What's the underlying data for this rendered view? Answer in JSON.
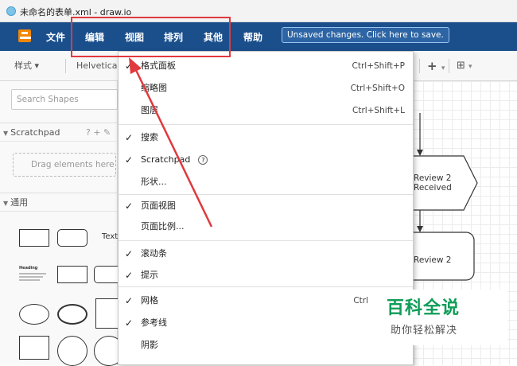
{
  "window": {
    "title": "未命名的表单.xml - draw.io"
  },
  "menubar": {
    "items": [
      "文件",
      "编辑",
      "视图",
      "排列",
      "其他",
      "帮助"
    ],
    "unsaved_notice": "Unsaved changes. Click here to save."
  },
  "toolbar": {
    "style_label": "样式",
    "font_label": "Helvetica",
    "plus_label": "+",
    "table_label": "⊞"
  },
  "sidebar": {
    "search_placeholder": "Search Shapes",
    "scratchpad": {
      "title": "Scratchpad",
      "controls": "? + ✎",
      "drop_text": "Drag elements here"
    },
    "general": {
      "title": "通用"
    },
    "text_shape_label": "Text",
    "heading_thumb_label": "Heading"
  },
  "view_menu": {
    "items": [
      {
        "label": "格式面板",
        "shortcut": "Ctrl+Shift+P",
        "checked": true
      },
      {
        "label": "缩略图",
        "shortcut": "Ctrl+Shift+O",
        "checked": false
      },
      {
        "label": "图层",
        "shortcut": "Ctrl+Shift+L",
        "checked": false
      },
      {
        "label": "搜索",
        "shortcut": "",
        "checked": true
      },
      {
        "label": "Scratchpad",
        "shortcut": "",
        "checked": true
      },
      {
        "label": "形状...",
        "shortcut": "",
        "checked": false
      },
      {
        "label": "页面视图",
        "shortcut": "",
        "checked": true
      },
      {
        "label": "页面比例...",
        "shortcut": "",
        "checked": false
      },
      {
        "label": "滚动条",
        "shortcut": "",
        "checked": true
      },
      {
        "label": "提示",
        "shortcut": "",
        "checked": true
      },
      {
        "label": "网格",
        "shortcut": "Ctrl",
        "checked": true
      },
      {
        "label": "参考线",
        "shortcut": "",
        "checked": true
      },
      {
        "label": "阴影",
        "shortcut": "",
        "checked": false
      }
    ]
  },
  "canvas": {
    "node1_label": "Review 2\nReceived",
    "node2_label": "Review 2"
  },
  "watermark": {
    "title": "百科全说",
    "subtitle": "助你轻松解决"
  },
  "colors": {
    "menubar": "#1b4f8c",
    "highlight": "#e0393e",
    "watermark_green": "#0f9d58"
  }
}
